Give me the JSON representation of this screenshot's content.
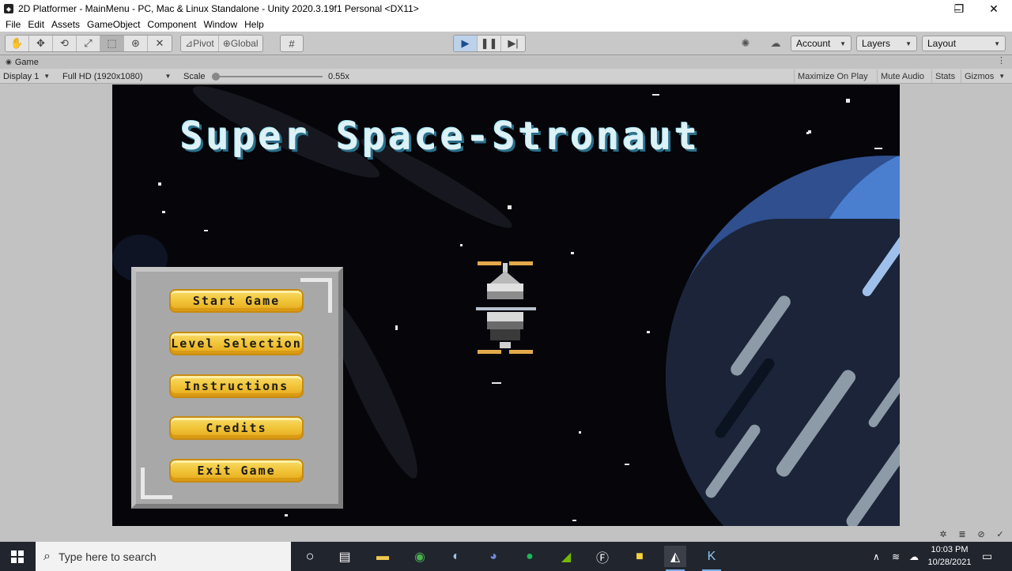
{
  "window": {
    "title": "2D Platformer - MainMenu - PC, Mac & Linux Standalone - Unity 2020.3.19f1 Personal <DX11>",
    "controls": {
      "minimize": "–",
      "maximize": "❐",
      "close": "✕"
    }
  },
  "menu": [
    "File",
    "Edit",
    "Assets",
    "GameObject",
    "Component",
    "Window",
    "Help"
  ],
  "toolbar": {
    "tools": [
      "hand-icon",
      "move-icon",
      "rotate-icon",
      "scale-icon",
      "rect-icon",
      "transform-icon",
      "custom-tool-icon"
    ],
    "pivot_label": "Pivot",
    "global_label": "Global",
    "account_label": "Account",
    "layers_label": "Layers",
    "layout_label": "Layout",
    "accent": "#1b4d8f"
  },
  "game_tab": {
    "label": "Game",
    "display": "Display 1",
    "resolution": "Full HD (1920x1080)",
    "scale_label": "Scale",
    "scale_value": "0.55x",
    "maximize_on_play": "Maximize On Play",
    "mute_audio": "Mute Audio",
    "stats": "Stats",
    "gizmos": "Gizmos"
  },
  "game": {
    "title": "Super Space-Stronaut",
    "buttons": [
      "Start Game",
      "Level Selection",
      "Instructions",
      "Credits",
      "Exit Game"
    ],
    "colors": {
      "sky": "#05050a",
      "title": "#dcf2f6",
      "button": "#f2c73c",
      "panel": "#a8a8a8",
      "planet": "#4a7fd0"
    }
  },
  "taskbar": {
    "search_placeholder": "Type here to search",
    "apps": [
      "cortana-icon",
      "task-view-icon",
      "file-explorer-icon",
      "chrome-icon",
      "steam-icon",
      "discord-icon",
      "spotify-icon",
      "nvidia-icon",
      "f-app-icon",
      "sticky-notes-icon",
      "unity-icon",
      "krita-icon"
    ],
    "time": "10:03 PM",
    "date": "10/28/2021"
  }
}
